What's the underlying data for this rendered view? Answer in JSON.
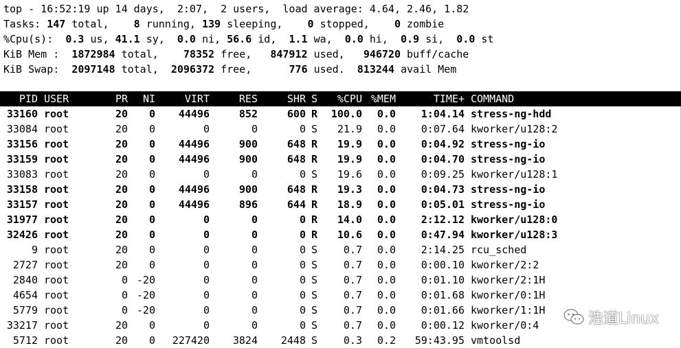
{
  "summary": {
    "line1": "top - 16:52:19 up 14 days,  2:07,  2 users,  load average: 4.64, 2.46, 1.82",
    "tasks": {
      "label": "Tasks:",
      "total": "147",
      "total_lbl": "total,",
      "running": "8",
      "running_lbl": "running,",
      "sleeping": "139",
      "sleeping_lbl": "sleeping,",
      "stopped": "0",
      "stopped_lbl": "stopped,",
      "zombie": "0",
      "zombie_lbl": "zombie"
    },
    "cpu": {
      "label": "%Cpu(s):",
      "us": "0.3",
      "us_lbl": "us,",
      "sy": "41.1",
      "sy_lbl": "sy,",
      "ni": "0.0",
      "ni_lbl": "ni,",
      "id": "56.6",
      "id_lbl": "id,",
      "wa": "1.1",
      "wa_lbl": "wa,",
      "hi": "0.0",
      "hi_lbl": "hi,",
      "si": "0.9",
      "si_lbl": "si,",
      "st": "0.0",
      "st_lbl": "st"
    },
    "mem": {
      "label": "KiB Mem :",
      "total": "1872984",
      "total_lbl": "total,",
      "free": "78352",
      "free_lbl": "free,",
      "used": "847912",
      "used_lbl": "used,",
      "buff": "946720",
      "buff_lbl": "buff/cache"
    },
    "swap": {
      "label": "KiB Swap:",
      "total": "2097148",
      "total_lbl": "total,",
      "free": "2096372",
      "free_lbl": "free,",
      "used": "776",
      "used_lbl": "used.",
      "avail": "813244",
      "avail_lbl": "avail Mem"
    }
  },
  "columns": [
    "PID",
    "USER",
    "PR",
    "NI",
    "VIRT",
    "RES",
    "SHR",
    "S",
    "%CPU",
    "%MEM",
    "TIME+",
    "COMMAND"
  ],
  "processes": [
    {
      "pid": "33160",
      "user": "root",
      "pr": "20",
      "ni": "0",
      "virt": "44496",
      "res": "852",
      "shr": "600",
      "s": "R",
      "cpu": "100.0",
      "mem": "0.0",
      "time": "1:04.14",
      "cmd": "stress-ng-hdd",
      "bold": true
    },
    {
      "pid": "33084",
      "user": "root",
      "pr": "20",
      "ni": "0",
      "virt": "0",
      "res": "0",
      "shr": "0",
      "s": "S",
      "cpu": "21.9",
      "mem": "0.0",
      "time": "0:07.64",
      "cmd": "kworker/u128:2",
      "bold": false
    },
    {
      "pid": "33156",
      "user": "root",
      "pr": "20",
      "ni": "0",
      "virt": "44496",
      "res": "900",
      "shr": "648",
      "s": "R",
      "cpu": "19.9",
      "mem": "0.0",
      "time": "0:04.92",
      "cmd": "stress-ng-io",
      "bold": true
    },
    {
      "pid": "33159",
      "user": "root",
      "pr": "20",
      "ni": "0",
      "virt": "44496",
      "res": "900",
      "shr": "648",
      "s": "R",
      "cpu": "19.9",
      "mem": "0.0",
      "time": "0:04.70",
      "cmd": "stress-ng-io",
      "bold": true
    },
    {
      "pid": "33083",
      "user": "root",
      "pr": "20",
      "ni": "0",
      "virt": "0",
      "res": "0",
      "shr": "0",
      "s": "S",
      "cpu": "19.6",
      "mem": "0.0",
      "time": "0:09.25",
      "cmd": "kworker/u128:1",
      "bold": false
    },
    {
      "pid": "33158",
      "user": "root",
      "pr": "20",
      "ni": "0",
      "virt": "44496",
      "res": "900",
      "shr": "648",
      "s": "R",
      "cpu": "19.3",
      "mem": "0.0",
      "time": "0:04.73",
      "cmd": "stress-ng-io",
      "bold": true
    },
    {
      "pid": "33157",
      "user": "root",
      "pr": "20",
      "ni": "0",
      "virt": "44496",
      "res": "896",
      "shr": "644",
      "s": "R",
      "cpu": "18.9",
      "mem": "0.0",
      "time": "0:05.01",
      "cmd": "stress-ng-io",
      "bold": true
    },
    {
      "pid": "31977",
      "user": "root",
      "pr": "20",
      "ni": "0",
      "virt": "0",
      "res": "0",
      "shr": "0",
      "s": "R",
      "cpu": "14.0",
      "mem": "0.0",
      "time": "2:12.12",
      "cmd": "kworker/u128:0",
      "bold": true
    },
    {
      "pid": "32426",
      "user": "root",
      "pr": "20",
      "ni": "0",
      "virt": "0",
      "res": "0",
      "shr": "0",
      "s": "R",
      "cpu": "10.6",
      "mem": "0.0",
      "time": "0:47.94",
      "cmd": "kworker/u128:3",
      "bold": true
    },
    {
      "pid": "9",
      "user": "root",
      "pr": "20",
      "ni": "0",
      "virt": "0",
      "res": "0",
      "shr": "0",
      "s": "S",
      "cpu": "0.7",
      "mem": "0.0",
      "time": "2:14.25",
      "cmd": "rcu_sched",
      "bold": false
    },
    {
      "pid": "2727",
      "user": "root",
      "pr": "20",
      "ni": "0",
      "virt": "0",
      "res": "0",
      "shr": "0",
      "s": "S",
      "cpu": "0.7",
      "mem": "0.0",
      "time": "0:00.10",
      "cmd": "kworker/2:2",
      "bold": false
    },
    {
      "pid": "2840",
      "user": "root",
      "pr": "0",
      "ni": "-20",
      "virt": "0",
      "res": "0",
      "shr": "0",
      "s": "S",
      "cpu": "0.7",
      "mem": "0.0",
      "time": "0:01.10",
      "cmd": "kworker/2:1H",
      "bold": false
    },
    {
      "pid": "4654",
      "user": "root",
      "pr": "0",
      "ni": "-20",
      "virt": "0",
      "res": "0",
      "shr": "0",
      "s": "S",
      "cpu": "0.7",
      "mem": "0.0",
      "time": "0:01.68",
      "cmd": "kworker/0:1H",
      "bold": false
    },
    {
      "pid": "5779",
      "user": "root",
      "pr": "0",
      "ni": "-20",
      "virt": "0",
      "res": "0",
      "shr": "0",
      "s": "S",
      "cpu": "0.7",
      "mem": "0.0",
      "time": "0:01.66",
      "cmd": "kworker/1:1H",
      "bold": false
    },
    {
      "pid": "33217",
      "user": "root",
      "pr": "20",
      "ni": "0",
      "virt": "0",
      "res": "0",
      "shr": "0",
      "s": "S",
      "cpu": "0.7",
      "mem": "0.0",
      "time": "0:00.12",
      "cmd": "kworker/0:4",
      "bold": false
    },
    {
      "pid": "5712",
      "user": "root",
      "pr": "20",
      "ni": "0",
      "virt": "227420",
      "res": "3824",
      "shr": "2448",
      "s": "S",
      "cpu": "0.3",
      "mem": "0.2",
      "time": "59:43.95",
      "cmd": "vmtoolsd",
      "bold": false
    }
  ],
  "watermark": {
    "text": "浩道Linux",
    "icon": "wechat-icon"
  }
}
